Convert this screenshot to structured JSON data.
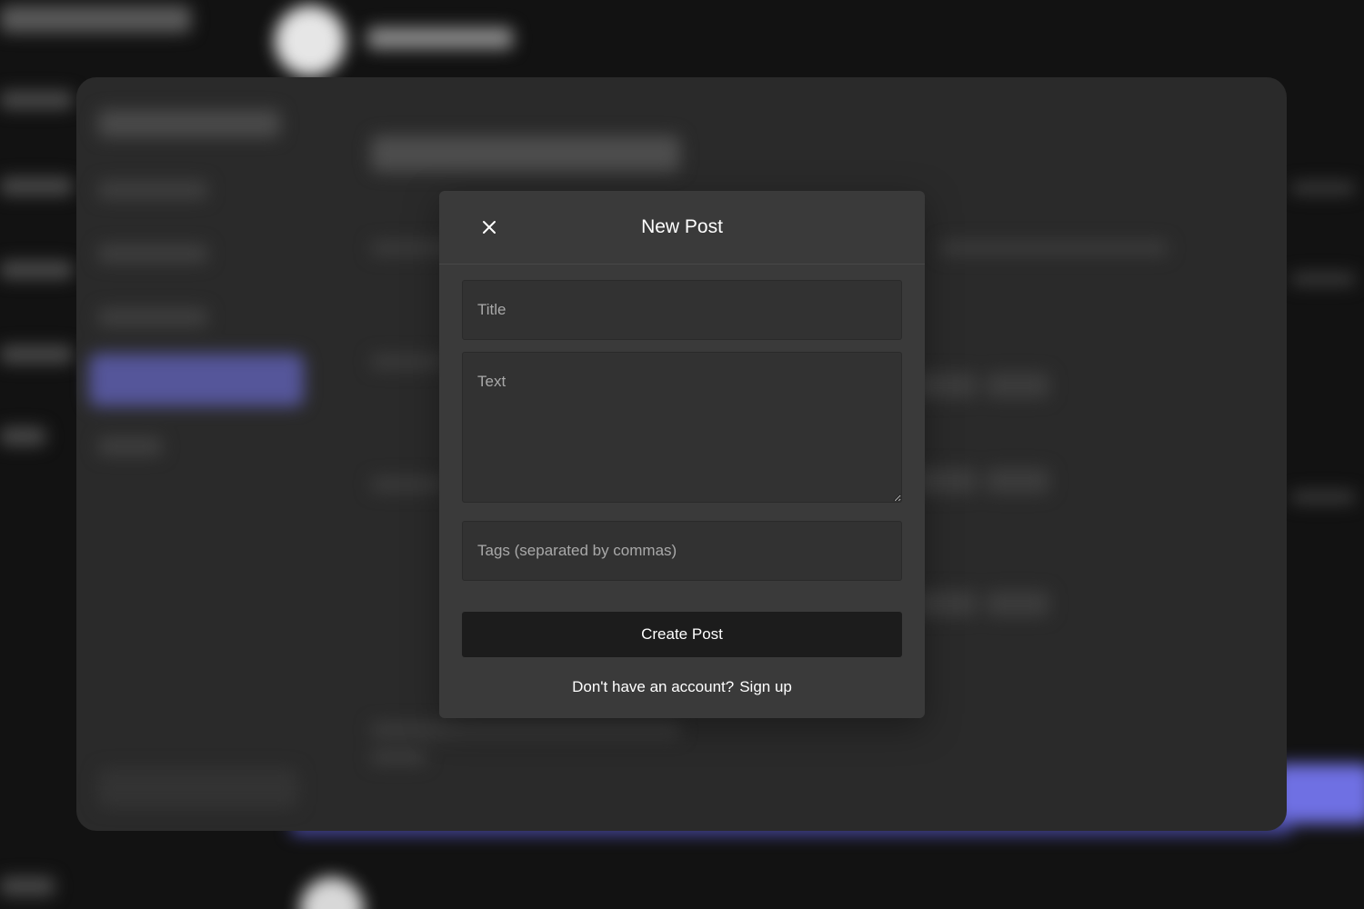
{
  "modal": {
    "title": "New Post",
    "close_icon": "close-icon",
    "fields": {
      "title_placeholder": "Title",
      "text_placeholder": "Text",
      "tags_placeholder": "Tags (separated by commas)"
    },
    "submit_label": "Create Post",
    "footer_prompt": "Don't have an account?",
    "footer_link": "Sign up"
  },
  "colors": {
    "page_background": "#121212",
    "panel_background": "#2a2a2a",
    "modal_background": "#3a3a3a",
    "input_background": "#323232",
    "button_background": "#1c1c1c",
    "accent": "#6f70e3"
  }
}
